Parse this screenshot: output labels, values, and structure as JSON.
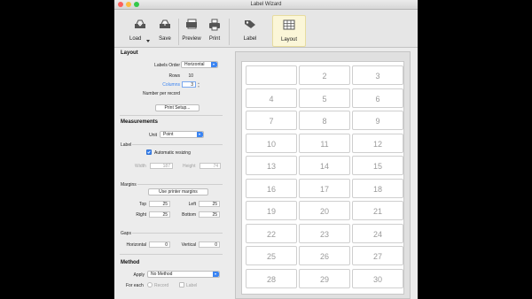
{
  "window": {
    "title": "Label Wizard"
  },
  "toolbar": {
    "load": "Load",
    "save": "Save",
    "preview": "Preview",
    "print": "Print",
    "label": "Label",
    "layout": "Layout"
  },
  "layout": {
    "heading": "Layout",
    "labels_order_label": "Labels Order",
    "labels_order_value": "Horizontal",
    "rows_label": "Rows",
    "rows_value": "10",
    "columns_label": "Columns",
    "columns_value": "3",
    "number_per_record_label": "Number per record",
    "print_setup_button": "Print Setup..."
  },
  "measurements": {
    "heading": "Measurements",
    "unit_label": "Unit",
    "unit_value": "Point",
    "label_section": "Label",
    "auto_resizing": "Automatic resizing",
    "width_label": "Width",
    "width_value": "187",
    "height_label": "Height",
    "height_value": "74",
    "margins_section": "Margins",
    "use_printer_margins": "Use printer margins",
    "top_label": "Top",
    "top_value": "25",
    "left_label": "Left",
    "left_value": "25",
    "right_label": "Right",
    "right_value": "25",
    "bottom_label": "Bottom",
    "bottom_value": "25",
    "gaps_section": "Gaps",
    "horizontal_label": "Horizontal",
    "horizontal_value": "0",
    "vertical_label": "Vertical",
    "vertical_value": "0"
  },
  "method": {
    "heading": "Method",
    "apply_label": "Apply",
    "apply_value": "No Method",
    "for_each_label": "For each",
    "record_option": "Record",
    "label_option": "Label"
  },
  "grid": {
    "rows": [
      [
        "",
        "2",
        "3"
      ],
      [
        "4",
        "5",
        "6"
      ],
      [
        "7",
        "8",
        "9"
      ],
      [
        "10",
        "11",
        "12"
      ],
      [
        "13",
        "14",
        "15"
      ],
      [
        "16",
        "17",
        "18"
      ],
      [
        "19",
        "20",
        "21"
      ],
      [
        "22",
        "23",
        "24"
      ],
      [
        "25",
        "26",
        "27"
      ],
      [
        "28",
        "29",
        "30"
      ]
    ]
  },
  "colors": {
    "accent": "#3a84f2",
    "selected_tool": "#fbf6d8"
  }
}
